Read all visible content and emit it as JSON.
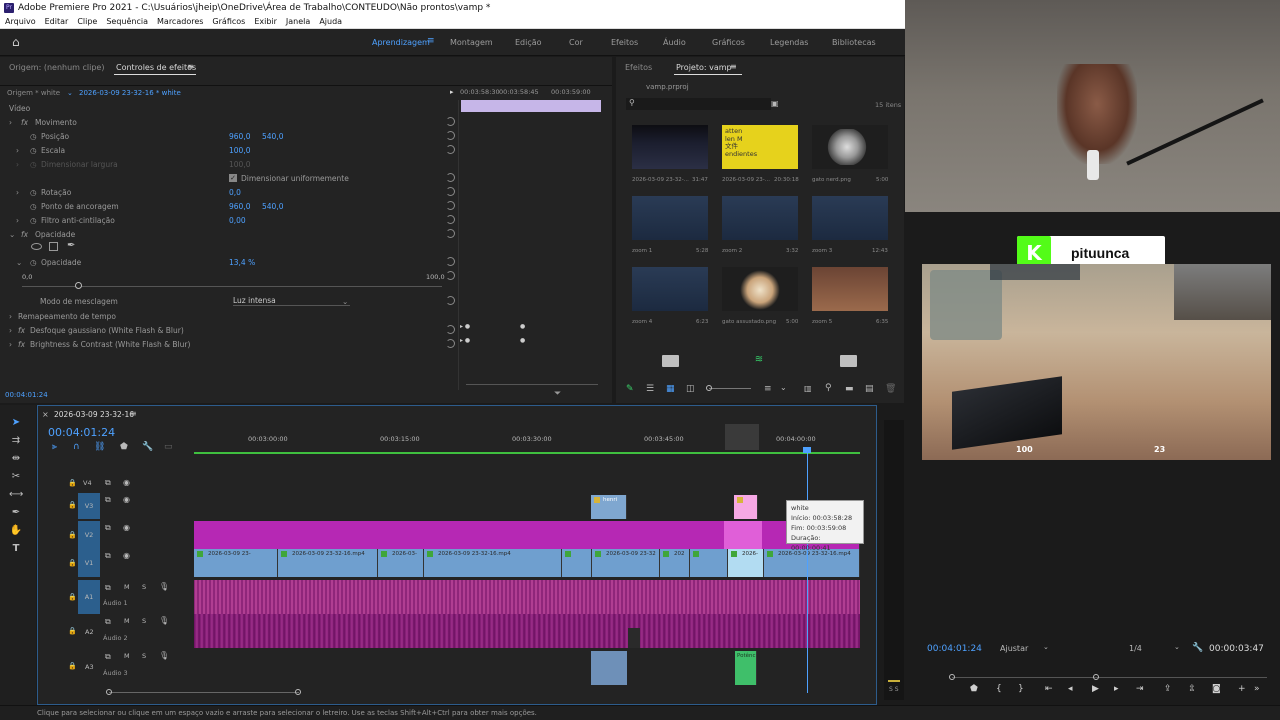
{
  "window": {
    "title": "Adobe Premiere Pro 2021 - C:\\Usuários\\jheip\\OneDrive\\Área de Trabalho\\CONTEUDO\\Não prontos\\vamp *",
    "app_icon": "Pr"
  },
  "menu": [
    "Arquivo",
    "Editar",
    "Clipe",
    "Sequência",
    "Marcadores",
    "Gráficos",
    "Exibir",
    "Janela",
    "Ajuda"
  ],
  "workspaces": [
    "Aprendizagem",
    "Montagem",
    "Edição",
    "Cor",
    "Efeitos",
    "Áudio",
    "Gráficos",
    "Legendas",
    "Bibliotecas"
  ],
  "effect_controls": {
    "tab_source": "Origem: (nenhum clipe)",
    "tab_active": "Controles de efeitos",
    "clip_source": "Origem * white",
    "clip_seq": "2026-03-09 23-32-16 * white",
    "mini_time_a": "00:03:58:30",
    "mini_time_b": "00:03:58:45",
    "mini_time_c": "00:03:59:00",
    "section_video": "Vídeo",
    "movement": "Movimento",
    "position_label": "Posição",
    "position_x": "960,0",
    "position_y": "540,0",
    "scale_label": "Escala",
    "scale_val": "100,0",
    "width_label": "Dimensionar largura",
    "width_val": "100,0",
    "uniform_label": "Dimensionar uniformemente",
    "rotation_label": "Rotação",
    "rotation_val": "0,0",
    "anchor_label": "Ponto de ancoragem",
    "anchor_x": "960,0",
    "anchor_y": "540,0",
    "flicker_label": "Filtro anti-cintilação",
    "flicker_val": "0,00",
    "opacity_section": "Opacidade",
    "opacity_label": "Opacidade",
    "opacity_val": "13,4 %",
    "slider_min": "0,0",
    "slider_max": "100,0",
    "blend_label": "Modo de mesclagem",
    "blend_val": "Luz intensa",
    "remap": "Remapeamento de tempo",
    "blur": "Desfoque gaussiano (White Flash & Blur)",
    "brightness": "Brightness & Contrast (White Flash & Blur)",
    "time": "00:04:01:24"
  },
  "project": {
    "tab_effects": "Efeitos",
    "tab_project": "Projeto: vamp",
    "file": "vamp.prproj",
    "count": "15 itens",
    "items": [
      {
        "name": "2026-03-09 23-32-...",
        "dur": "31:47"
      },
      {
        "name": "2026-03-09 23-...",
        "dur": "20:30:18"
      },
      {
        "name": "gato nerd.png",
        "dur": "5:00"
      },
      {
        "name": "zoom 1",
        "dur": "5:28"
      },
      {
        "name": "zoom 2",
        "dur": "3:32"
      },
      {
        "name": "zoom 3",
        "dur": "12:43"
      },
      {
        "name": "zoom 4",
        "dur": "6:23"
      },
      {
        "name": "gato assustado.png",
        "dur": "5:00"
      },
      {
        "name": "zoom 5",
        "dur": "6:35"
      }
    ],
    "thumb_text": "atten\nlen M\n文件\nendientes"
  },
  "timeline": {
    "seq_name": "2026-03-09 23-32-16",
    "timecode": "00:04:01:24",
    "ruler": [
      "00:03:00:00",
      "00:03:15:00",
      "00:03:30:00",
      "00:03:45:00",
      "00:04:00:00"
    ],
    "tracks_video": [
      "V4",
      "V3",
      "V2",
      "V1"
    ],
    "tracks_audio": [
      "A1",
      "A2",
      "A3"
    ],
    "audio_names": [
      "Áudio 1",
      "Áudio 2",
      "Áudio 3"
    ],
    "clip_v1": [
      "2026-03-09 23-",
      "2026-03-09 23-32-16.mp4",
      "2026-03-",
      "2026-03-09 23-32-16.mp4",
      "2026-03-09 23-32",
      "202",
      "2026-",
      "2026-03-09 23-32-16.mp4"
    ],
    "clip_v3": "henri",
    "clip_a3": "Potênc",
    "tooltip": {
      "name": "white",
      "start": "Início: 00:03:58:28",
      "end": "Fim: 00:03:59:08",
      "dur": "Duração: 00:00:00:41"
    }
  },
  "program": {
    "time": "00:04:01:24",
    "fit": "Ajustar",
    "res": "1/4",
    "dur": "00:00:03:47"
  },
  "overlay": {
    "channel": "pituunca",
    "health": "100",
    "ammo": "23"
  },
  "status": "Clique para selecionar ou clique em um espaço vazio e arraste para selecionar o letreiro. Use as teclas Shift+Alt+Ctrl para obter mais opções.",
  "colors": {
    "accent": "#4ea1ff",
    "v1": "#6f9fcf",
    "v2": "#b628b4",
    "audio": "#7e1a6f",
    "kick": "#53fc18"
  }
}
